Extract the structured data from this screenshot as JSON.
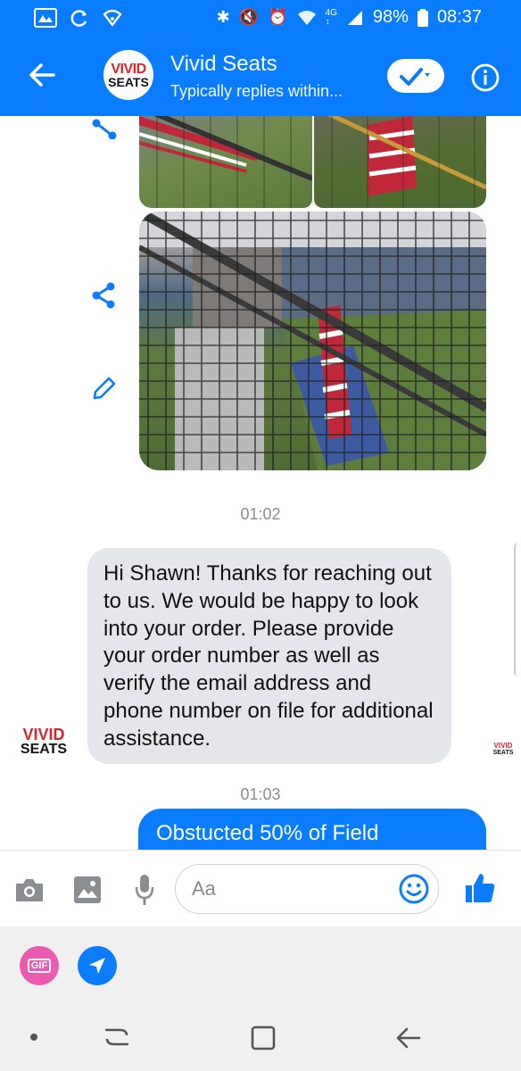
{
  "status_bar": {
    "battery": "98%",
    "time": "08:37"
  },
  "header": {
    "logo_line1": "VIVID",
    "logo_line2": "SEATS",
    "title": "Vivid Seats",
    "subtitle": "Typically replies within..."
  },
  "messages": {
    "time1": "01:02",
    "incoming_text": "Hi Shawn! Thanks for reaching out to us. We would be happy to look into your order. Please provide your order number as well as verify the email address and phone number on file for additional assistance.",
    "avatar_line1": "VIVID",
    "avatar_line2": "SEATS",
    "time2": "01:03",
    "outgoing_text": "Obstucted 50% of Field"
  },
  "composer": {
    "placeholder": "Aa",
    "gif_label": "GIF"
  },
  "colors": {
    "brand_blue": "#0a7cff",
    "vivid_red": "#d7262e"
  }
}
